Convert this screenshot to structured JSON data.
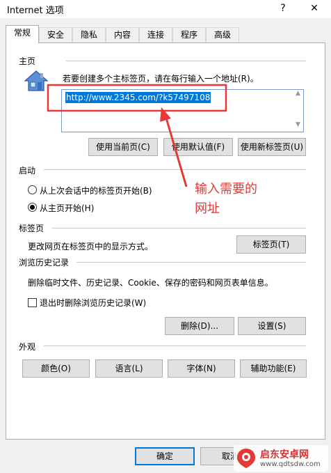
{
  "window": {
    "title": "Internet 选项",
    "help_glyph": "?",
    "close_glyph": "✕"
  },
  "tabs": [
    "常规",
    "安全",
    "隐私",
    "内容",
    "连接",
    "程序",
    "高级"
  ],
  "homepage": {
    "section_title": "主页",
    "description": "若要创建多个主标签页，请在每行输入一个地址(R)。",
    "url": "http://www.2345.com/?k57497108",
    "buttons": {
      "use_current": "使用当前页(C)",
      "use_default": "使用默认值(F)",
      "use_new_tab": "使用新标签页(U)"
    }
  },
  "startup": {
    "section_title": "启动",
    "option_last_session": "从上次会话中的标签页开始(B)",
    "option_homepage": "从主页开始(H)",
    "selected": "homepage"
  },
  "tabs_section": {
    "section_title": "标签页",
    "description": "更改网页在标签页中的显示方式。",
    "button": "标签页(T)"
  },
  "history": {
    "section_title": "浏览历史记录",
    "description": "删除临时文件、历史记录、Cookie、保存的密码和网页表单信息。",
    "checkbox_label": "退出时删除浏览历史记录(W)",
    "checkbox_checked": false,
    "delete_button": "删除(D)...",
    "settings_button": "设置(S)"
  },
  "appearance": {
    "section_title": "外观",
    "colors_button": "颜色(O)",
    "languages_button": "语言(L)",
    "fonts_button": "字体(N)",
    "accessibility_button": "辅助功能(E)"
  },
  "footer": {
    "ok_button": "确定",
    "cancel_button": "取消"
  },
  "annotation": {
    "line1": "输入需要的",
    "line2": "网址",
    "color": "#e53935"
  },
  "watermark": {
    "name": "启东安卓网",
    "url": "www.qdtsdw.com"
  }
}
